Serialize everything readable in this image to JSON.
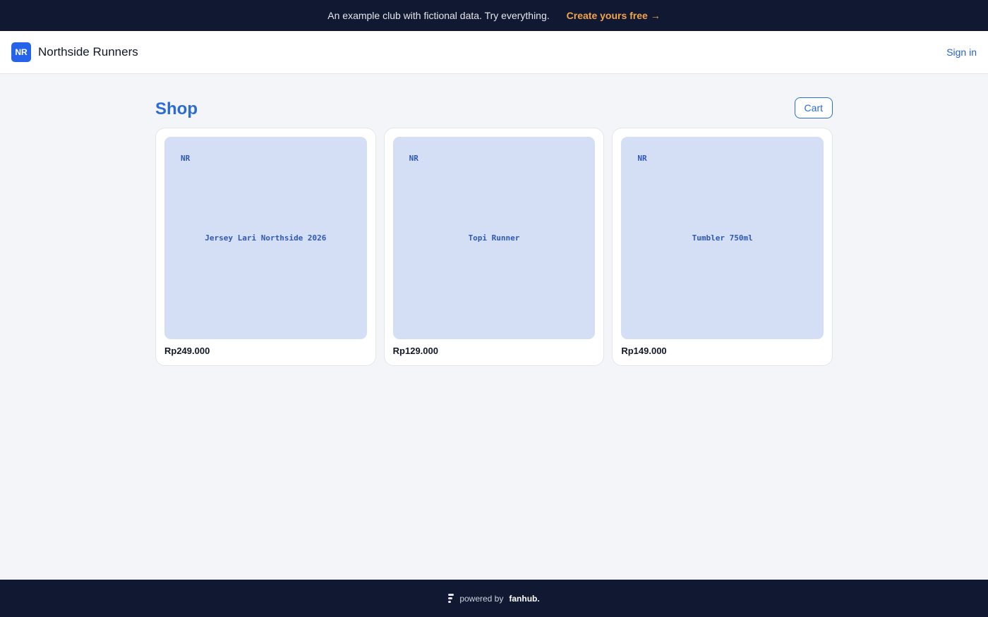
{
  "banner": {
    "text": "An example club with fictional data. Try everything.",
    "cta_label": "Create yours free →"
  },
  "header": {
    "logo_initials": "NR",
    "club_name": "Northside Runners",
    "signin_label": "Sign in"
  },
  "shop": {
    "title": "Shop",
    "cart_label": "Cart",
    "products": [
      {
        "mark": "NR",
        "name": "Jersey Lari Northside 2026",
        "price": "Rp249.000"
      },
      {
        "mark": "NR",
        "name": "Topi Runner",
        "price": "Rp129.000"
      },
      {
        "mark": "NR",
        "name": "Tumbler 750ml",
        "price": "Rp149.000"
      }
    ]
  },
  "footer": {
    "powered_by": "powered by",
    "brand": "fanhub.",
    "icon": "fanhub-logo-icon"
  },
  "colors": {
    "dark_bg": "#111831",
    "accent": "#2b6cd4",
    "cta": "#f2a54a",
    "thumb_bg": "#d4dff6"
  }
}
